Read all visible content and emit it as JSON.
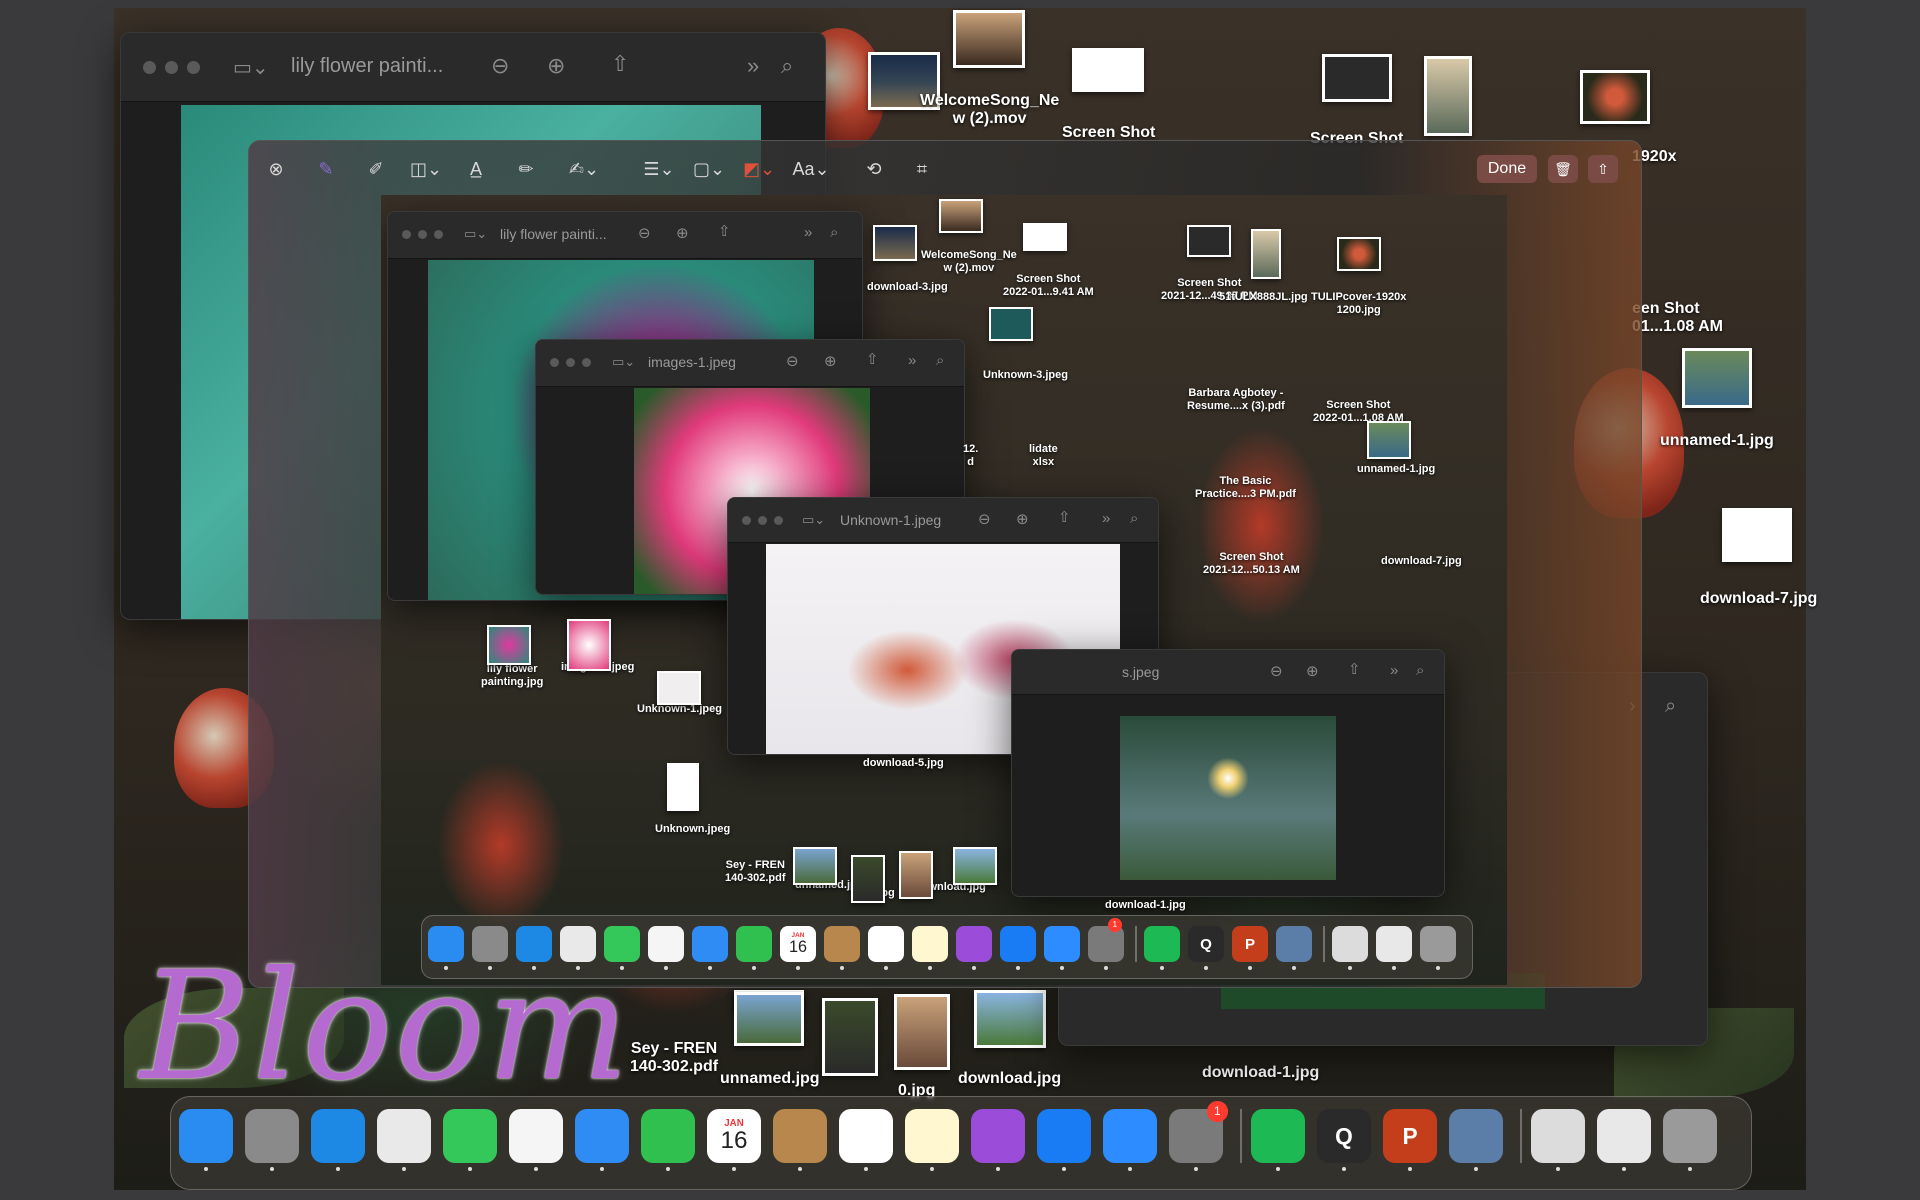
{
  "desktop": {
    "labels": [
      {
        "id": "welcome",
        "text": "WelcomeSong_Ne\nw (2).mov"
      },
      {
        "id": "screenshot1",
        "text": "Screen Shot"
      },
      {
        "id": "screenshot2",
        "text": "Screen Shot"
      },
      {
        "id": "tulip",
        "text": "1920x"
      },
      {
        "id": "screenshot3",
        "text": "een Shot\n01...1.08 AM"
      },
      {
        "id": "unnamed1",
        "text": "unnamed-1.jpg"
      },
      {
        "id": "download7",
        "text": "download-7.jpg"
      },
      {
        "id": "sey",
        "text": "Sey - FREN\n140-302.pdf"
      },
      {
        "id": "unnamed",
        "text": "unnamed.jpg"
      },
      {
        "id": "zero",
        "text": "0.jpg"
      },
      {
        "id": "download",
        "text": "download.jpg"
      },
      {
        "id": "download1",
        "text": "download-1.jpg"
      }
    ],
    "bloom_text": "Bloom"
  },
  "back_window": {
    "title": "lily flower painti...",
    "toolbar_icons": [
      "sidebar-toggle-icon",
      "zoom-out-icon",
      "zoom-in-icon",
      "share-icon",
      "chevrons-icon",
      "search-icon"
    ]
  },
  "markup": {
    "done_label": "Done",
    "tools": [
      "close-icon",
      "sketch-icon",
      "draw-icon",
      "shapes-icon",
      "textbox-icon",
      "highlight-icon",
      "sign-icon",
      "shape-style-icon",
      "border-color-icon",
      "fill-color-icon",
      "text-style-icon",
      "rotate-icon",
      "crop-icon"
    ],
    "text_style_label": "Aa",
    "inner": {
      "labels": [
        {
          "id": "i_download3",
          "text": "download-3.jpg"
        },
        {
          "id": "i_welcome",
          "text": "WelcomeSong_Ne\nw (2).mov"
        },
        {
          "id": "i_ss1",
          "text": "Screen Shot\n2022-01...9.41 AM"
        },
        {
          "id": "i_ss2",
          "text": "Screen Shot\n2021-12...49.37 PM"
        },
        {
          "id": "i_lx",
          "text": "51tULX888JL.jpg"
        },
        {
          "id": "i_tulip",
          "text": "TULIPcover-1920x\n1200.jpg"
        },
        {
          "id": "i_unknown3",
          "text": "Unknown-3.jpeg"
        },
        {
          "id": "i_barbara",
          "text": "Barbara Agbotey -\nResume....x (3).pdf"
        },
        {
          "id": "i_ss3",
          "text": "Screen Shot\n2022-01...1.08 AM"
        },
        {
          "id": "i_unnamed1",
          "text": "unnamed-1.jpg"
        },
        {
          "id": "i_lidate",
          "text": "lidate\nxlsx"
        },
        {
          "id": "i_basic",
          "text": "The Basic\nPractice....3 PM.pdf"
        },
        {
          "id": "i_ss4",
          "text": "Screen Shot\n2021-12...50.13 AM"
        },
        {
          "id": "i_download7",
          "text": "download-7.jpg"
        },
        {
          "id": "i_lily",
          "text": "lily flower\npainting.jpg"
        },
        {
          "id": "i_images1",
          "text": "images-1.jpeg"
        },
        {
          "id": "i_unknown1",
          "text": "Unknown-1.jpeg"
        },
        {
          "id": "i_unknown",
          "text": "Unknown.jpeg"
        },
        {
          "id": "i_sey",
          "text": "Sey - FREN\n140-302.pdf"
        },
        {
          "id": "i_unnamed",
          "text": "unnamed.jpg"
        },
        {
          "id": "i_zero",
          "text": "0.jpg"
        },
        {
          "id": "i_download",
          "text": "download.jpg"
        },
        {
          "id": "i_download5",
          "text": "download-5.jpg"
        },
        {
          "id": "i_download1",
          "text": "download-1.jpg"
        },
        {
          "id": "i_12",
          "text": "12.\nd"
        }
      ],
      "win_lily_title": "lily flower painti...",
      "win_images_title": "images-1.jpeg",
      "win_unknown_title": "Unknown-1.jpeg",
      "win_s_title": "s.jpeg"
    }
  },
  "dock": {
    "apps": [
      {
        "name": "finder",
        "label": "",
        "color": "#2a8cf0"
      },
      {
        "name": "launchpad",
        "label": "",
        "color": "#8a8a8a"
      },
      {
        "name": "safari",
        "label": "",
        "color": "#1e88e5"
      },
      {
        "name": "chrome",
        "label": "",
        "color": "#e9e9e9"
      },
      {
        "name": "messages",
        "label": "",
        "color": "#34c759"
      },
      {
        "name": "photos",
        "label": "",
        "color": "#f5f5f5"
      },
      {
        "name": "mail",
        "label": "",
        "color": "#2f8cf5"
      },
      {
        "name": "facetime",
        "label": "",
        "color": "#30c050"
      },
      {
        "name": "calendar",
        "label": "16",
        "month": "JAN",
        "color": "#ffffff"
      },
      {
        "name": "contacts",
        "label": "",
        "color": "#b7874e"
      },
      {
        "name": "reminders",
        "label": "",
        "color": "#ffffff"
      },
      {
        "name": "notes",
        "label": "",
        "color": "#fff7cf"
      },
      {
        "name": "podcasts",
        "label": "",
        "color": "#9b4dd9"
      },
      {
        "name": "app-store",
        "label": "",
        "color": "#1a7cf5"
      },
      {
        "name": "zoom",
        "label": "",
        "color": "#2d8cff"
      },
      {
        "name": "system-preferences",
        "label": "",
        "color": "#7a7a7a",
        "badge": "1"
      },
      {
        "name": "spotify",
        "label": "",
        "color": "#1db954"
      },
      {
        "name": "quicktime",
        "label": "Q",
        "color": "#2a2a2a"
      },
      {
        "name": "powerpoint",
        "label": "P",
        "color": "#c43e1c"
      },
      {
        "name": "preview",
        "label": "",
        "color": "#5a7ea8"
      },
      {
        "name": "recent-window-1",
        "label": "",
        "color": "#dcdcdc"
      },
      {
        "name": "recent-window-2",
        "label": "",
        "color": "#e8e8e8"
      },
      {
        "name": "trash",
        "label": "",
        "color": "#9a9a9a"
      }
    ]
  }
}
